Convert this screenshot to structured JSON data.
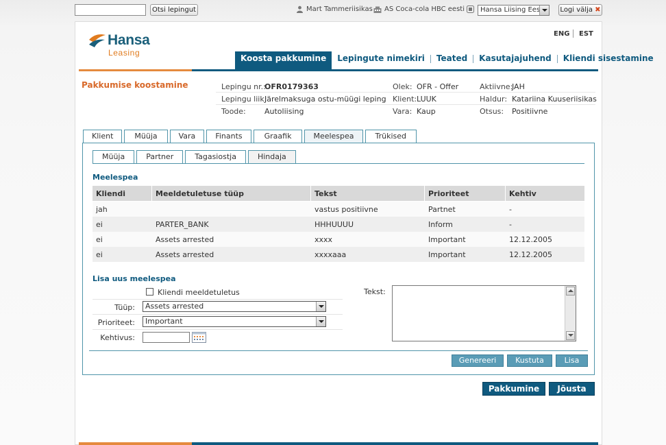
{
  "topbar": {
    "search_placeholder": "",
    "search_button": "Otsi lepingut",
    "user_name": "Mart Tammeriisikas",
    "company_name": "AS Coca-cola HBC eesti",
    "selected_company": "Hansa Liising Eesti",
    "logout_label": "Logi välja",
    "logout_icon": "close-icon"
  },
  "logo": {
    "name": "Hansa",
    "sub": "Leasing"
  },
  "languages": [
    "ENG",
    "EST"
  ],
  "nav": {
    "items": [
      "Koosta pakkumine",
      "Lepingute nimekiri",
      "Teated",
      "Kasutajajuhend",
      "Kliendi sisestamine"
    ],
    "active_index": 0
  },
  "page_title": "Pakkumise koostamine",
  "contract_info": {
    "row1": {
      "l1": "Lepingu nr.:",
      "v1": "OFR0179363",
      "l2": "Olek:",
      "v2": "OFR - Offer",
      "l3": "Aktiivne:",
      "v3": "JAH"
    },
    "row2": {
      "l1": "Lepingu liik:",
      "v1": "Järelmaksuga ostu-müügi leping",
      "l2": "Klient:",
      "v2": "LUUK",
      "l3": "Haldur:",
      "v3": "Katariina Kuuseriisikas"
    },
    "row3": {
      "l1": "Toode:",
      "v1": "Autoliising",
      "l2": "Vara:",
      "v2": "Kaup",
      "l3": "Otsus:",
      "v3": "Positiivne"
    }
  },
  "tabs": {
    "items": [
      "Klient",
      "Müüja",
      "Vara",
      "Finants",
      "Graafik",
      "Meelespea",
      "Trükised"
    ],
    "active_index": 5
  },
  "subtabs": {
    "items": [
      "Müüja",
      "Partner",
      "Tagasiostja",
      "Hindaja"
    ],
    "active_index": 3
  },
  "reminders": {
    "title": "Meelespea",
    "columns": [
      "Kliendi",
      "Meeldetuletuse tüüp",
      "Tekst",
      "Prioriteet",
      "Kehtiv"
    ],
    "rows": [
      [
        "jah",
        "",
        "vastus positiivne",
        "Partnet",
        "-"
      ],
      [
        "ei",
        "PARTER_BANK",
        "HHHUUUU",
        "Inform",
        "-"
      ],
      [
        "ei",
        "Assets arrested",
        "xxxx",
        "Important",
        "12.12.2005"
      ],
      [
        "ei",
        "Assets arrested",
        "xxxxaaa",
        "Important",
        "12.12.2005"
      ]
    ]
  },
  "new_reminder": {
    "title": "Lisa uus meelespea",
    "client_reminder_label": "Kliendi meeldetuletus",
    "type_label": "Tüüp:",
    "type_value": "Assets arrested",
    "priority_label": "Prioriteet:",
    "priority_value": "Important",
    "valid_label": "Kehtivus:",
    "valid_value": "",
    "text_label": "Tekst:",
    "text_value": ""
  },
  "actions": {
    "generate": "Genereeri",
    "delete": "Kustuta",
    "add": "Lisa"
  },
  "footer_buttons": {
    "offer": "Pakkumine",
    "enforce": "Jõusta"
  },
  "colors": {
    "brand_blue": "#0f5a7f",
    "brand_orange": "#e58a3e",
    "tab_border": "#4f94a9",
    "action_button": "#5a9cb6"
  }
}
